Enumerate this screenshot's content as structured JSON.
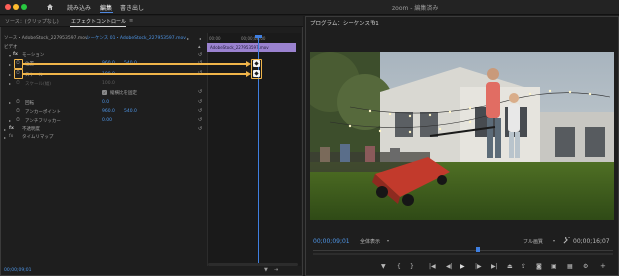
{
  "app": {
    "window_title": "zoom - 編集済み",
    "home_icon": "home-icon",
    "workspaces": [
      "読み込み",
      "編集",
      "書き出し"
    ],
    "active_workspace": "編集",
    "traffic_lights": [
      "#fe5f57",
      "#febc2e",
      "#28c840"
    ]
  },
  "left_panel": {
    "tabs": [
      "ソース：(クリップなし)",
      "エフェクトコントロール"
    ],
    "active_tab": "エフェクトコントロール",
    "menu_icon": "≡",
    "source_clip": "ソース・AdobeStock_227953597.mov",
    "sequence_clip": "シーケンス 01・AdobeStock_227953597.mov",
    "section_label": "ビデオ",
    "motion_label": "モーション",
    "params": [
      {
        "label": "位置",
        "value": "960.0",
        "value2": "540.0"
      },
      {
        "label": "スケール",
        "value": "100.0"
      },
      {
        "label": "スケール(幅)",
        "value": "100.0"
      },
      {
        "label": "縦横比を固定",
        "checked": true
      },
      {
        "label": "回転",
        "value": "0.0"
      },
      {
        "label": "アンカーポイント",
        "value": "960.0",
        "value2": "540.0"
      },
      {
        "label": "アンチフリッカー",
        "value": "0.00"
      }
    ],
    "opacity_label": "不透明度",
    "timeremap_label": "タイムリマップ",
    "timeline": {
      "time_start": "00:00",
      "time_mid": "00;00;08;00",
      "clip_name": "AdobeStock_227953597.mov"
    },
    "current_time": "00;00;09;01"
  },
  "program": {
    "title": "プログラム：シーケンス 01",
    "menu_icon": "≡",
    "timecode": "00;00;09;01",
    "zoom": "全体表示",
    "quality": "フル画質",
    "duration": "00;00;16;07",
    "wrench_icon": "wrench-icon",
    "controls": [
      "マーカーを追加",
      "インをマーク",
      "アウトをマーク",
      "インへ移動",
      "1フレーム前へ戻る",
      "再生",
      "1フレーム先へ進む",
      "アウトへ移動",
      "リフト",
      "抽出",
      "フレームを書き出し",
      "比較表示",
      "ボタンエディター"
    ]
  },
  "colors": {
    "accent_blue": "#3f7fe0",
    "keyframe_highlight": "#f0b54a",
    "clip_purple": "#9a82cf",
    "value_blue": "#4e95e6"
  }
}
